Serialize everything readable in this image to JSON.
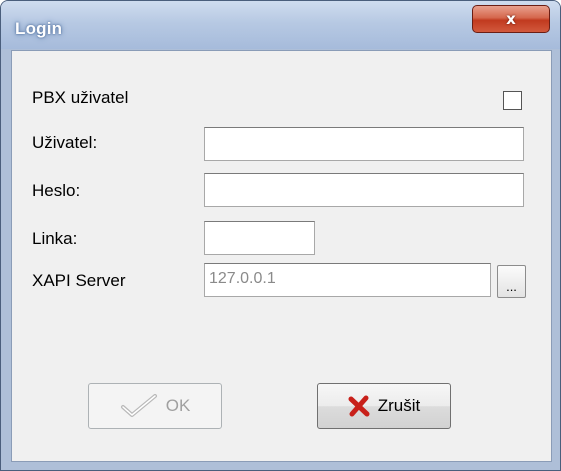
{
  "window": {
    "title": "Login",
    "close_glyph": "x"
  },
  "form": {
    "pbx_user_label": "PBX uživatel",
    "pbx_user_checked": false,
    "user_label": "Uživatel:",
    "user_value": "",
    "password_label": "Heslo:",
    "password_value": "",
    "line_label": "Linka:",
    "line_value": "",
    "server_label": "XAPI Server",
    "server_value": "127.0.0.1",
    "browse_label": "..."
  },
  "buttons": {
    "ok_label": "OK",
    "ok_icon": "check-icon",
    "ok_enabled": false,
    "cancel_label": "Zrušit",
    "cancel_icon": "red-x-icon",
    "cancel_enabled": true
  },
  "colors": {
    "title_text": "#ffffff",
    "close_button": "#c13a1f",
    "cancel_icon": "#c8201a",
    "disabled_text": "#a0a0a0"
  }
}
